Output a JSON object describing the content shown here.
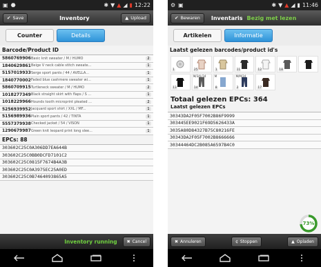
{
  "left": {
    "statusbar": {
      "time": "12:22"
    },
    "actionbar": {
      "save_label": "Save",
      "title": "Inventory",
      "upload_label": "Upload"
    },
    "tabs": [
      {
        "label": "Counter",
        "active": false
      },
      {
        "label": "Details",
        "active": true
      }
    ],
    "barcode_header": "Barcode/Product ID",
    "barcodes": [
      {
        "id": "5860769906",
        "desc": "Basic knit sweater / M / HUMO",
        "count": "2"
      },
      {
        "id": "1840629861",
        "desc": "Beige V neck cable stitch sweate...",
        "count": "1"
      },
      {
        "id": "5157019933",
        "desc": "Serge sport pants / 44 / AVELLA...",
        "count": "1"
      },
      {
        "id": "1840770002",
        "desc": "Faded blue cashmere sweater wi...",
        "count": "1"
      },
      {
        "id": "5860709915",
        "desc": "Turtleneck sweater / M / HUMO",
        "count": "2"
      },
      {
        "id": "1018277349",
        "desc": "Black straight skirt with flaps / S ...",
        "count": "1"
      },
      {
        "id": "1018229966",
        "desc": "Hounds tooth microprint pleated ...",
        "count": "2"
      },
      {
        "id": "5256939952",
        "desc": "Jacquard sport shirt / XXL / MF...",
        "count": "1"
      },
      {
        "id": "5156989936",
        "desc": "Plain sport pants / 42 / TINTA",
        "count": "1"
      },
      {
        "id": "5557379938",
        "desc": "Checked jacket / 54 / VISON",
        "count": "1"
      },
      {
        "id": "1290679987",
        "desc": "Green knit leopard print long slee...",
        "count": "1"
      }
    ],
    "epcs_header": "EPCs: 88",
    "epcs": [
      "303602C25C0A306DD7EA644B",
      "303602C25C0BB0DCFD7101C2",
      "303602C25C0815F7674B4A3B",
      "303602C25C0A3975EC25A0ED",
      "303602C25C0B7464093865A5"
    ],
    "bottombar": {
      "status": "Inventory running",
      "cancel_label": "Cancel"
    }
  },
  "right": {
    "statusbar": {
      "time": "11:46"
    },
    "actionbar": {
      "save_label": "Bewaren",
      "title": "Inventaris",
      "status": "Bezig met lezen"
    },
    "tabs": [
      {
        "label": "Artikelen",
        "active": false
      },
      {
        "label": "Informatie",
        "active": true
      }
    ],
    "barcode_header": "Laatst gelezen barcodes/product id's",
    "thumbnails": [
      {
        "label": "",
        "count": "1"
      },
      {
        "label": "",
        "count": "25"
      },
      {
        "label": "",
        "count": "1"
      },
      {
        "label": "",
        "count": "11"
      },
      {
        "label": "",
        "count": "12"
      },
      {
        "label": "",
        "count": "18"
      },
      {
        "label": "",
        "count": ""
      },
      {
        "label": "",
        "count": "13"
      },
      {
        "label": "M/34L/34",
        "count": "14"
      },
      {
        "label": "M",
        "count": "8"
      },
      {
        "label": "M/M/34",
        "count": "2"
      },
      {
        "label": "",
        "count": "17"
      }
    ],
    "total": "Totaal gelezen EPCs: 364",
    "epcs_header": "Laatst gelezen EPCs",
    "epcs": [
      "30343DA2F05F7002B86F9999",
      "303445EE9021F69D5626433A",
      "3035A80D84327B75C80216FE",
      "30343DA2F05F7002B8666666",
      "30344464DC2B085A6597B4C0"
    ],
    "progress": {
      "percent": 73,
      "label": "73%"
    },
    "bottombar": {
      "cancel_label": "Annuleren",
      "stop_label": "Stoppen",
      "upload_label": "Opladen"
    }
  },
  "colors": {
    "accent_blue": "#2e93d8",
    "status_green": "#6fd03e",
    "progress_green": "#3a9a2c"
  }
}
